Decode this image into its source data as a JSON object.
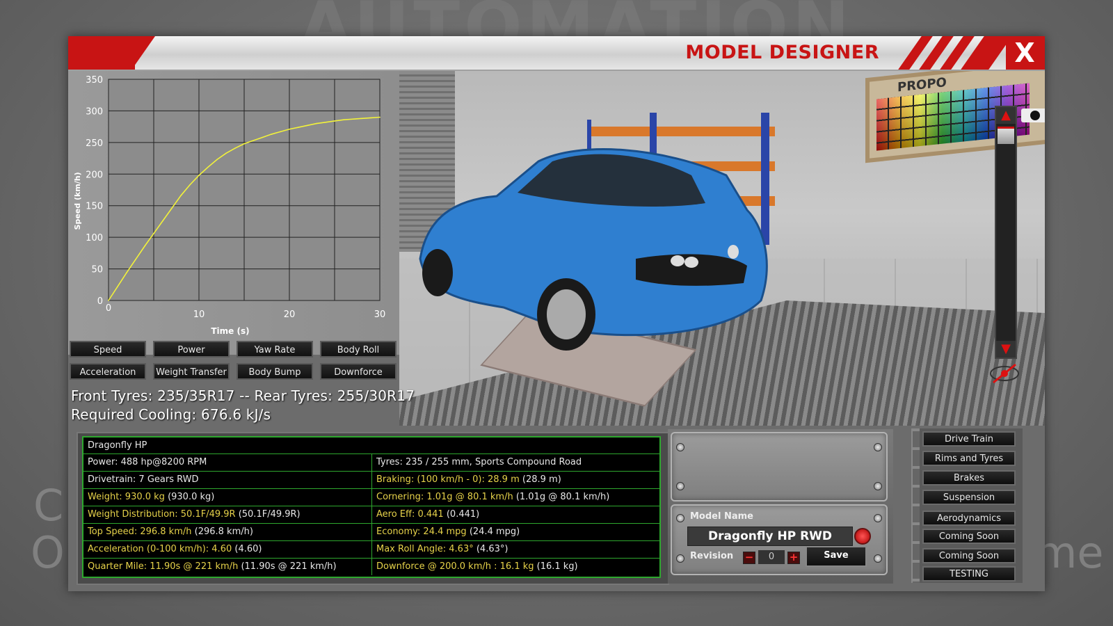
{
  "background": {
    "logo_text": "AUTOMATION",
    "left_letters": [
      "C",
      "O"
    ],
    "right_text": "me"
  },
  "window": {
    "title": "MODEL DESIGNER",
    "close_label": "X",
    "accent_color": "#c81414"
  },
  "chart_data": {
    "type": "line",
    "xlabel": "Time (s)",
    "ylabel": "Speed (km/h)",
    "xlim": [
      0,
      30
    ],
    "ylim": [
      0,
      350
    ],
    "xticks": [
      0,
      10,
      20,
      30
    ],
    "yticks": [
      0,
      50,
      100,
      150,
      200,
      250,
      300,
      350
    ],
    "grid": true,
    "line_color": "#f2f23a",
    "series": [
      {
        "x": [
          0,
          1,
          2,
          3,
          4,
          5,
          6,
          7,
          8,
          9,
          10,
          11,
          12,
          13,
          14,
          15,
          16,
          17,
          18,
          19,
          20,
          21,
          22,
          23,
          24,
          25,
          26,
          27,
          28,
          29,
          30
        ],
        "values": [
          0,
          22,
          44,
          65,
          86,
          106,
          126,
          146,
          166,
          183,
          198,
          211,
          223,
          233,
          241,
          248,
          253,
          258,
          263,
          267,
          271,
          274,
          277,
          280,
          282,
          284,
          286,
          287,
          288,
          289,
          290
        ]
      }
    ]
  },
  "graph_buttons": [
    "Speed",
    "Power",
    "Yaw Rate",
    "Body Roll",
    "Acceleration",
    "Weight Transfer",
    "Body Bump",
    "Downforce"
  ],
  "scene": {
    "palette_label": "PROPO",
    "scroll_up_icon": "chevron-up-icon",
    "scroll_down_icon": "chevron-down-icon",
    "camera_icon": "camera-icon",
    "eye_icon": "eye-icon",
    "hide_icon": "eye-crossed-icon"
  },
  "info": {
    "tyres": "Front Tyres: 235/35R17 -- Rear Tyres: 255/30R17",
    "cooling": "Required Cooling: 676.6 kJ/s"
  },
  "stats": {
    "title": "Dragonfly HP",
    "rows": [
      {
        "left_a": "Power: 488 hp@8200 RPM",
        "left_b": "",
        "right_a": "Tyres: 235 / 255 mm, Sports Compound Road",
        "right_b": ""
      },
      {
        "left_a": "Drivetrain: 7 Gears RWD",
        "left_b": "",
        "right_a": "Braking: (100 km/h - 0): 28.9 m",
        "right_b": " (28.9 m)"
      },
      {
        "left_a": "Weight: 930.0 kg",
        "left_b": " (930.0 kg)",
        "right_a": "Cornering: 1.01g @ 80.1 km/h",
        "right_b": " (1.01g @ 80.1 km/h)"
      },
      {
        "left_a": "Weight Distribution: 50.1F/49.9R",
        "left_b": " (50.1F/49.9R)",
        "right_a": "Aero Eff: 0.441",
        "right_b": " (0.441)"
      },
      {
        "left_a": "Top Speed: 296.8 km/h",
        "left_b": " (296.8 km/h)",
        "right_a": "Economy: 24.4 mpg",
        "right_b": " (24.4 mpg)"
      },
      {
        "left_a": "Acceleration (0-100 km/h): 4.60",
        "left_b": " (4.60)",
        "right_a": "Max Roll Angle: 4.63°",
        "right_b": " (4.63°)"
      },
      {
        "left_a": "Quarter Mile: 11.90s @ 221 km/h",
        "left_b": " (11.90s @ 221 km/h)",
        "right_a": "Downforce @ 200.0 km/h : 16.1 kg",
        "right_b": " (16.1 kg)"
      }
    ],
    "yellow_rows_left": [
      false,
      false,
      true,
      true,
      true,
      true,
      true
    ],
    "yellow_rows_right": [
      false,
      true,
      true,
      true,
      true,
      true,
      true
    ]
  },
  "model": {
    "name_label": "Model Name",
    "name_value": "Dragonfly HP RWD",
    "revision_label": "Revision",
    "revision_value": "0",
    "minus_label": "−",
    "plus_label": "+",
    "save_label": "Save"
  },
  "right_menu": [
    "Drive Train",
    "Rims and Tyres",
    "Brakes",
    "Suspension",
    "Aerodynamics",
    "Coming Soon",
    "Coming Soon",
    "TESTING"
  ]
}
